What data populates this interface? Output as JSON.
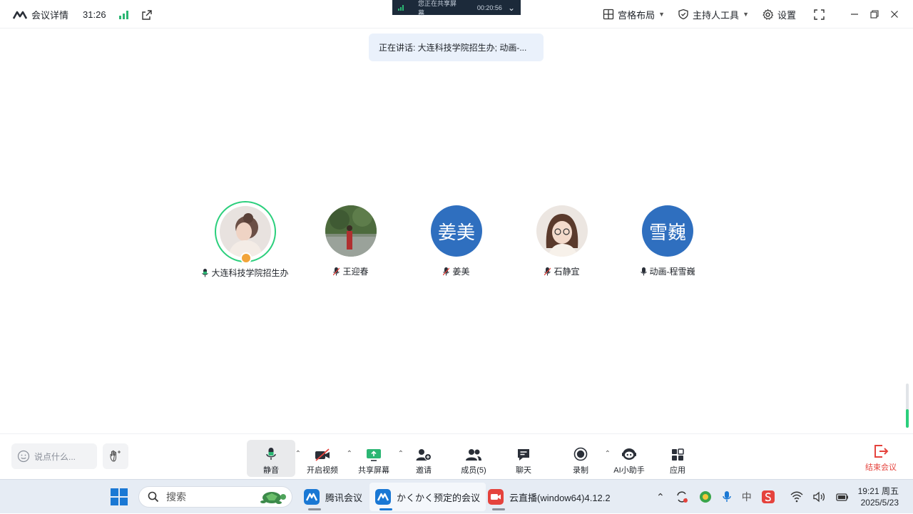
{
  "titlebar": {
    "meeting_details": "会议详情",
    "elapsed": "31:26",
    "layout_label": "宫格布局",
    "host_tools_label": "主持人工具",
    "settings_label": "设置"
  },
  "share_banner": {
    "text": "您正在共享屏幕",
    "time": "00:20:56"
  },
  "speaking_pill": "正在讲话: 大连科技学院招生办; 动画-...",
  "participants": [
    {
      "name": "大连科技学院招生办",
      "avatar_text": "",
      "mic": "on",
      "host": true
    },
    {
      "name": "王迎春",
      "avatar_text": "",
      "mic": "muted",
      "host": false
    },
    {
      "name": "姜美",
      "avatar_text": "姜美",
      "mic": "muted",
      "host": false
    },
    {
      "name": "石静宜",
      "avatar_text": "",
      "mic": "muted",
      "host": false
    },
    {
      "name": "动画-程雪巍",
      "avatar_text": "雪巍",
      "mic": "on",
      "host": false
    }
  ],
  "toolbar": {
    "chat_placeholder": "说点什么...",
    "mute_label": "静音",
    "video_label": "开启视频",
    "share_label": "共享屏幕",
    "invite_label": "邀请",
    "members_label": "成员(5)",
    "chat_label": "聊天",
    "record_label": "录制",
    "ai_label": "AI小助手",
    "apps_label": "应用",
    "end_label": "结束会议"
  },
  "taskbar": {
    "search_placeholder": "搜索",
    "tasks": [
      "腾讯会议",
      "かくかく预定的会议",
      "云直播(window64)4.12.2"
    ],
    "time": "19:21 周五",
    "date": "2025/5/23"
  },
  "colors": {
    "accent_blue": "#2f6fbf",
    "speaking_green": "#2bcf7c",
    "end_red": "#e5433d"
  }
}
